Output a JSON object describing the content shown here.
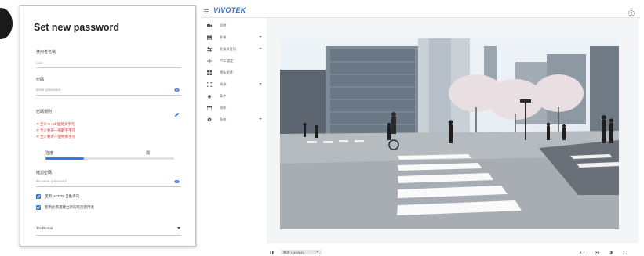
{
  "dialog": {
    "title": "Set new password",
    "username_label": "使用者名稱",
    "username_value": "root",
    "password_label": "密碼",
    "password_placeholder": "Enter password",
    "rules_title": "密碼規則",
    "rules": [
      "至少 8~64 個英文字元",
      "至少要有一個數字字元",
      "至少要有一個特殊字元"
    ],
    "strength_label": "強度",
    "strength_value": "弱",
    "strength_fraction": 0.3,
    "confirm_label": "確認密碼",
    "confirm_placeholder": "Re-enter password",
    "checkboxes": [
      {
        "label": "使用 HTTPS 自動導向",
        "checked": true
      },
      {
        "label": "使用此憑證建立新的帳密使用者",
        "checked": true
      }
    ],
    "select_value": "Traditional"
  },
  "app": {
    "logo": "VIVOTEK",
    "nav_items": [
      {
        "label": "即時",
        "icon": "video-icon",
        "has_chevron": false
      },
      {
        "label": "影像",
        "icon": "image-icon",
        "has_chevron": true
      },
      {
        "label": "影像與音訊",
        "icon": "settings-sliders-icon",
        "has_chevron": true
      },
      {
        "label": "PTZ 設定",
        "icon": "ptz-move-icon",
        "has_chevron": false
      },
      {
        "label": "隱私遮罩",
        "icon": "privacy-grid-icon",
        "has_chevron": false
      },
      {
        "label": "偵測",
        "icon": "detection-frame-icon",
        "has_chevron": true
      },
      {
        "label": "事件",
        "icon": "bell-icon",
        "has_chevron": false
      },
      {
        "label": "錄影",
        "icon": "calendar-icon",
        "has_chevron": false
      },
      {
        "label": "系統",
        "icon": "gear-icon",
        "has_chevron": true
      }
    ],
    "stream_label": "串流 1 (H.264)",
    "accent_color": "#2f7de1",
    "error_color": "#d93025"
  }
}
